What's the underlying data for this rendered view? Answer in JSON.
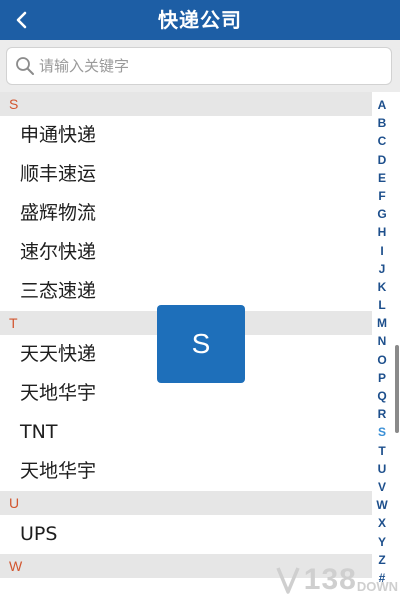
{
  "header": {
    "title": "快递公司",
    "back_icon": "chevron-left-icon"
  },
  "search": {
    "placeholder": "请输入关键字",
    "value": "",
    "icon": "search-icon"
  },
  "sections": [
    {
      "letter": "S",
      "items": [
        "申通快递",
        "顺丰速运",
        "盛辉物流",
        "速尔快递",
        "三态速递"
      ]
    },
    {
      "letter": "T",
      "items": [
        "天天快递",
        "天地华宇",
        "TNT",
        "天地华宇"
      ]
    },
    {
      "letter": "U",
      "items": [
        "UPS"
      ]
    },
    {
      "letter": "W",
      "items": []
    }
  ],
  "index_bar": {
    "letters": [
      "A",
      "B",
      "C",
      "D",
      "E",
      "F",
      "G",
      "H",
      "I",
      "J",
      "K",
      "L",
      "M",
      "N",
      "O",
      "P",
      "Q",
      "R",
      "S",
      "T",
      "U",
      "V",
      "W",
      "X",
      "Y",
      "Z",
      "#"
    ],
    "active": "S"
  },
  "overlay": {
    "letter": "S"
  },
  "watermark": {
    "number": "138",
    "text": "DOWN"
  },
  "colors": {
    "header_bg": "#1d5ea5",
    "section_letter": "#d2562f",
    "index_letter": "#1d4f8c",
    "index_active": "#3a8fd6",
    "overlay_bg": "#1e6fba"
  }
}
